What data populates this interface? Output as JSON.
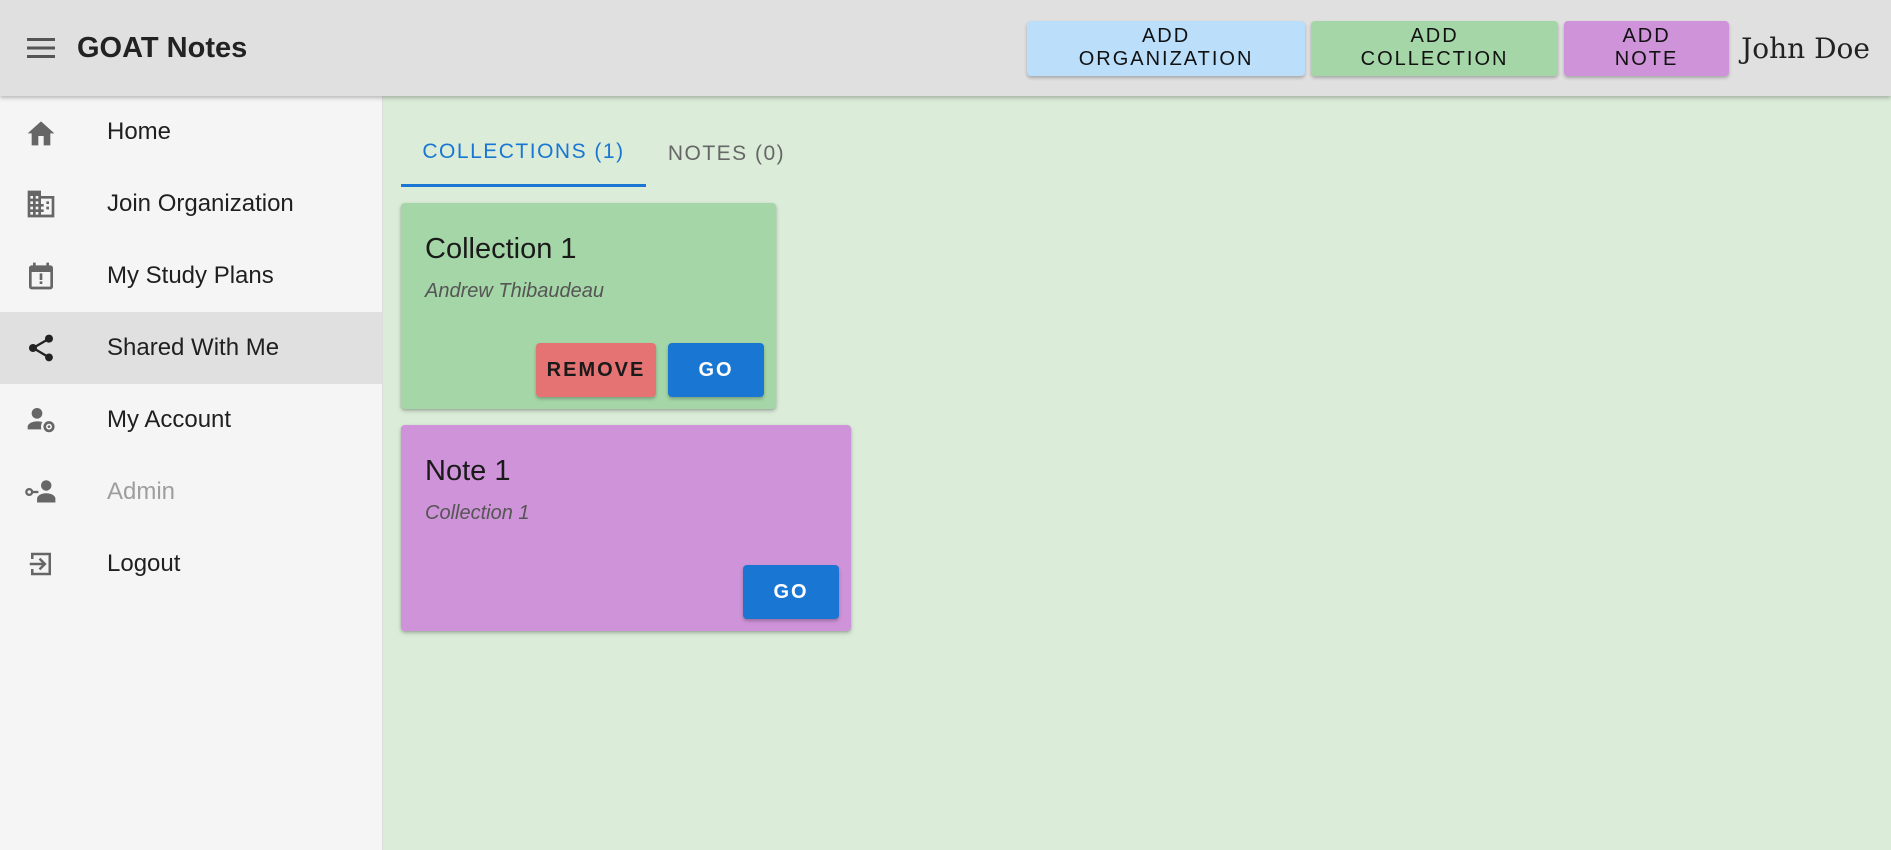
{
  "app": {
    "title": "GOAT Notes",
    "user_name": "John Doe"
  },
  "toolbar": {
    "add_organization": "ADD ORGANIZATION",
    "add_collection": "ADD COLLECTION",
    "add_note": "ADD NOTE"
  },
  "sidebar": {
    "items": [
      {
        "label": "Home",
        "icon": "home-icon"
      },
      {
        "label": "Join Organization",
        "icon": "building-icon"
      },
      {
        "label": "My Study Plans",
        "icon": "calendar-alert-icon"
      },
      {
        "label": "Shared With Me",
        "icon": "share-icon",
        "active": true
      },
      {
        "label": "My Account",
        "icon": "account-settings-icon"
      },
      {
        "label": "Admin",
        "icon": "admin-key-icon",
        "disabled": true
      },
      {
        "label": "Logout",
        "icon": "logout-icon"
      }
    ]
  },
  "tabs": [
    {
      "label": "COLLECTIONS (1)",
      "active": true
    },
    {
      "label": "NOTES (0)",
      "active": false
    }
  ],
  "cards": [
    {
      "type": "collection",
      "title": "Collection 1",
      "subtitle": "Andrew Thibaudeau",
      "remove_label": "REMOVE",
      "go_label": "GO"
    },
    {
      "type": "note",
      "title": "Note 1",
      "subtitle": "Collection 1",
      "go_label": "GO"
    }
  ],
  "colors": {
    "appbar": "#e0e0e0",
    "content_bg": "#dbecd9",
    "collection_card": "#a5d6a7",
    "note_card": "#ce93d8",
    "primary": "#1976d2",
    "remove": "#e57373"
  }
}
